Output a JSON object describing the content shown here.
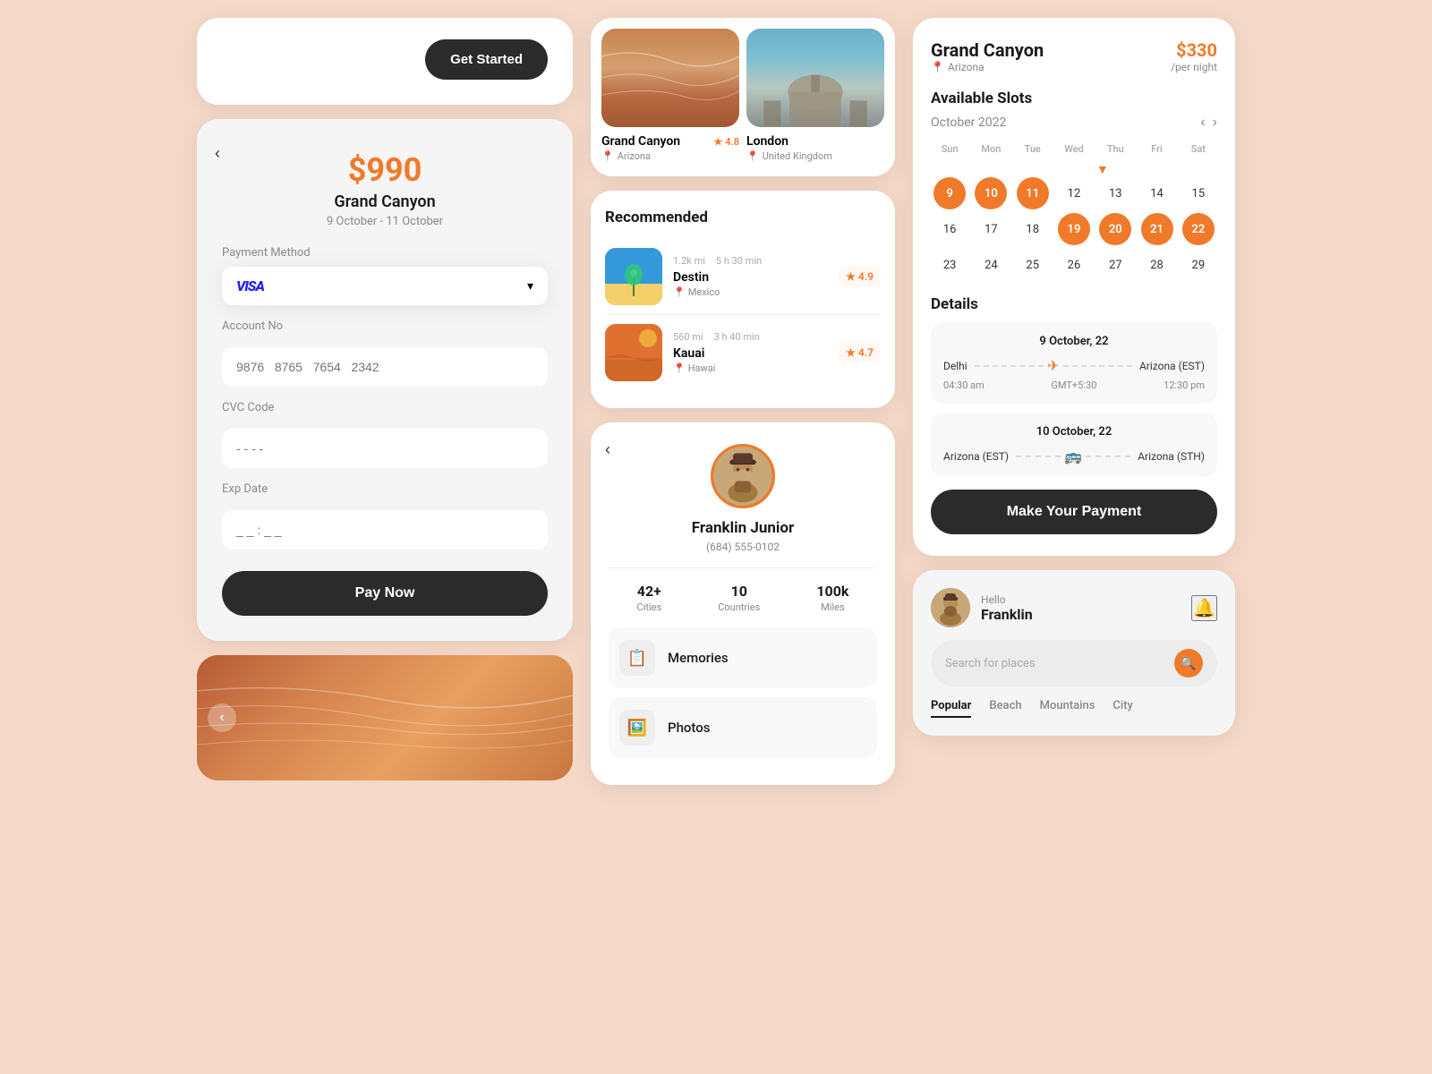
{
  "col1": {
    "get_started": {
      "button_label": "Get Started"
    },
    "payment": {
      "back_label": "‹",
      "amount": "$990",
      "destination": "Grand Canyon",
      "dates": "9 October  -  11 October",
      "payment_method_label": "Payment Method",
      "payment_method_placeholder": "VISA",
      "dropdown_arrow": "▾",
      "account_no_label": "Account No",
      "account_no_placeholder": "9876   8765   7654   2342",
      "cvc_label": "CVC Code",
      "cvc_placeholder": "- - - -",
      "exp_label": "Exp Date",
      "exp_placeholder": "_ _ : _ _",
      "pay_button_label": "Pay Now"
    }
  },
  "col2": {
    "destinations": {
      "grand_canyon": {
        "name": "Grand Canyon",
        "location": "Arizona",
        "rating": "4.8"
      },
      "london": {
        "name": "London",
        "location": "United Kingdom",
        "rating": ""
      }
    },
    "recommended": {
      "section_title": "Recommended",
      "items": [
        {
          "name": "Destin",
          "location": "Mexico",
          "distance": "1.2k mi",
          "duration": "5 h 30 min",
          "rating": "4.9",
          "type": "destin"
        },
        {
          "name": "Kauai",
          "location": "Hawai",
          "distance": "560 mi",
          "duration": "3 h 40 min",
          "rating": "4.7",
          "type": "kauai"
        }
      ]
    },
    "profile": {
      "back_label": "‹",
      "name": "Franklin Junior",
      "phone": "(684) 555-0102",
      "stats": [
        {
          "value": "42+",
          "label": "Cities"
        },
        {
          "value": "10",
          "label": "Countries"
        },
        {
          "value": "100k",
          "label": "Miles"
        }
      ],
      "menu_items": [
        {
          "icon": "📋",
          "label": "Memories"
        },
        {
          "icon": "🖼️",
          "label": "Photos"
        }
      ]
    }
  },
  "col3": {
    "booking": {
      "title": "Grand Canyon",
      "location": "Arizona",
      "price": "$330",
      "per_night": "/per night",
      "available_slots_title": "Available Slots",
      "calendar_month": "October 2022",
      "nav_prev": "‹",
      "nav_next": "›",
      "day_headers": [
        "Sun",
        "Mon",
        "Tue",
        "Wed",
        "Thu",
        "Fri",
        "Sat"
      ],
      "weeks": [
        [
          {
            "num": "",
            "state": "empty"
          },
          {
            "num": "",
            "state": "empty"
          },
          {
            "num": "",
            "state": "empty"
          },
          {
            "num": "",
            "state": "empty"
          },
          {
            "num": "",
            "state": "empty"
          },
          {
            "num": "",
            "state": "empty"
          },
          {
            "num": "",
            "state": "empty"
          }
        ],
        [
          {
            "num": "9",
            "state": "selected"
          },
          {
            "num": "10",
            "state": "selected"
          },
          {
            "num": "11",
            "state": "selected"
          },
          {
            "num": "12",
            "state": "normal"
          },
          {
            "num": "13",
            "state": "normal"
          },
          {
            "num": "14",
            "state": "normal"
          },
          {
            "num": "15",
            "state": "normal"
          }
        ],
        [
          {
            "num": "16",
            "state": "normal"
          },
          {
            "num": "17",
            "state": "normal"
          },
          {
            "num": "18",
            "state": "normal"
          },
          {
            "num": "19",
            "state": "selected"
          },
          {
            "num": "20",
            "state": "selected"
          },
          {
            "num": "21",
            "state": "selected"
          },
          {
            "num": "22",
            "state": "selected"
          }
        ],
        [
          {
            "num": "23",
            "state": "normal"
          },
          {
            "num": "24",
            "state": "normal"
          },
          {
            "num": "25",
            "state": "normal"
          },
          {
            "num": "26",
            "state": "normal"
          },
          {
            "num": "27",
            "state": "normal"
          },
          {
            "num": "28",
            "state": "normal"
          },
          {
            "num": "29",
            "state": "normal"
          }
        ]
      ],
      "details_title": "Details",
      "flight1": {
        "date": "9 October, 22",
        "from": "Delhi",
        "to": "Arizona (EST)",
        "depart": "04:30 am",
        "gmt": "GMT+5:30",
        "arrive": "12:30 pm",
        "icon": "✈"
      },
      "flight2": {
        "date": "10 October, 22",
        "from": "Arizona (EST)",
        "to": "Arizona (STH)",
        "icon": "🚌"
      },
      "payment_button_label": "Make Your Payment"
    },
    "hello": {
      "greeting": "Hello",
      "name": "Franklin",
      "search_placeholder": "Search for places",
      "search_icon": "🔍",
      "bell_icon": "🔔",
      "categories": [
        {
          "label": "Popular",
          "active": true
        },
        {
          "label": "Beach",
          "active": false
        },
        {
          "label": "Mountains",
          "active": false
        },
        {
          "label": "City",
          "active": false
        }
      ]
    }
  }
}
